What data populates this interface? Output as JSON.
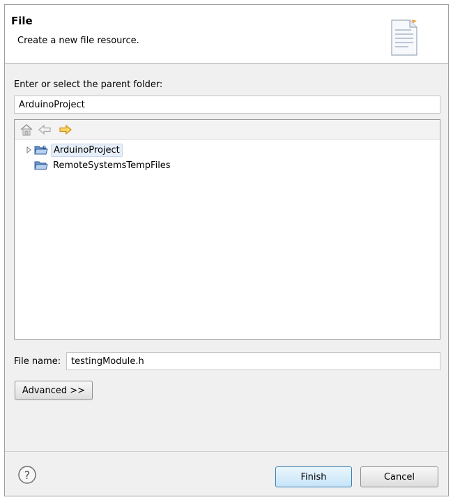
{
  "header": {
    "title": "File",
    "description": "Create a new file resource."
  },
  "parent_folder": {
    "label": "Enter or select the parent folder:",
    "value": "ArduinoProject"
  },
  "tree": {
    "toolbar": [
      "home-icon",
      "back-arrow-icon",
      "forward-arrow-icon"
    ],
    "items": [
      {
        "label": "ArduinoProject",
        "icon": "c-project-folder-icon",
        "expandable": true,
        "selected": true
      },
      {
        "label": "RemoteSystemsTempFiles",
        "icon": "open-folder-icon",
        "expandable": false,
        "selected": false
      }
    ]
  },
  "file_name": {
    "label": "File name:",
    "value": "testingModule.h"
  },
  "buttons": {
    "advanced": "Advanced >>",
    "finish": "Finish",
    "cancel": "Cancel"
  },
  "colors": {
    "dialog_bg": "#f0f0f0",
    "header_bg": "#ffffff",
    "default_button_border": "#3c7fb1",
    "forward_arrow": "#e8a317"
  }
}
